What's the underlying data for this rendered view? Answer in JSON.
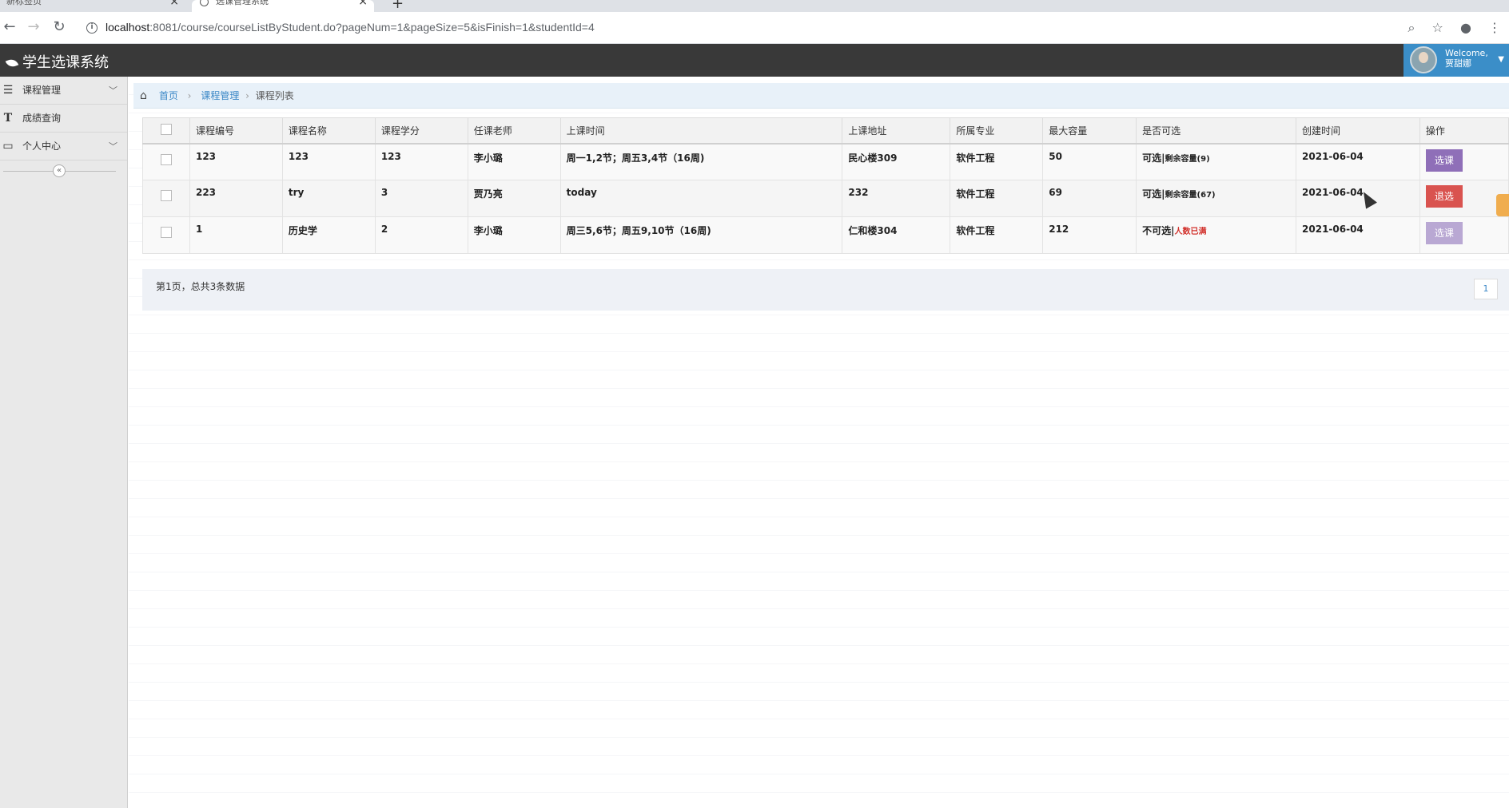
{
  "browser": {
    "tabs": [
      {
        "title": "新标签页"
      },
      {
        "title": "选课管理系统"
      }
    ],
    "url_host": "localhost",
    "url_path": ":8081/course/courseListByStudent.do?pageNum=1&pageSize=5&isFinish=1&studentId=4"
  },
  "header": {
    "app_title": "学生选课系统",
    "welcome": "Welcome,",
    "username": "贾甜娜"
  },
  "sidebar": {
    "items": [
      {
        "label": "课程管理",
        "icon": "list-icon",
        "expandable": true
      },
      {
        "label": "成绩查询",
        "icon": "text-icon",
        "expandable": false
      },
      {
        "label": "个人中心",
        "icon": "desktop-icon",
        "expandable": true
      }
    ],
    "collapse_glyph": "«"
  },
  "breadcrumb": {
    "items": [
      "首页",
      "课程管理"
    ],
    "current": "课程列表"
  },
  "table": {
    "columns": [
      "课程编号",
      "课程名称",
      "课程学分",
      "任课老师",
      "上课时间",
      "上课地址",
      "所属专业",
      "最大容量",
      "是否可选",
      "创建时间",
      "操作"
    ],
    "rows": [
      {
        "id": "123",
        "name": "123",
        "credit": "123",
        "teacher": "李小璐",
        "time": "周一1,2节；周五3,4节（16周)",
        "location": "民心楼309",
        "major": "软件工程",
        "capacity": "50",
        "avail": "可选|",
        "avail_note": "剩余容量(9)",
        "full": "",
        "created": "2021-06-04",
        "action": "选课",
        "action_style": "purple"
      },
      {
        "id": "223",
        "name": "try",
        "credit": "3",
        "teacher": "贾乃亮",
        "time": "today",
        "location": "232",
        "major": "软件工程",
        "capacity": "69",
        "avail": "可选|",
        "avail_note": "剩余容量(67)",
        "full": "",
        "created": "2021-06-04",
        "action": "退选",
        "action_style": "red"
      },
      {
        "id": "1",
        "name": "历史学",
        "credit": "2",
        "teacher": "李小璐",
        "time": "周三5,6节；周五9,10节（16周)",
        "location": "仁和楼304",
        "major": "软件工程",
        "capacity": "212",
        "avail": "不可选|",
        "avail_note": "",
        "full": "人数已满",
        "created": "2021-06-04",
        "action": "选课",
        "action_style": "disabled"
      }
    ]
  },
  "pager": {
    "info": "第1页，总共3条数据",
    "current_page": "1"
  },
  "colors": {
    "header_bg": "#393939",
    "user_box_bg": "#3b8ec8",
    "select_button": "#8f6fb8",
    "drop_button": "#d9534f",
    "full_text": "#d2322d"
  }
}
